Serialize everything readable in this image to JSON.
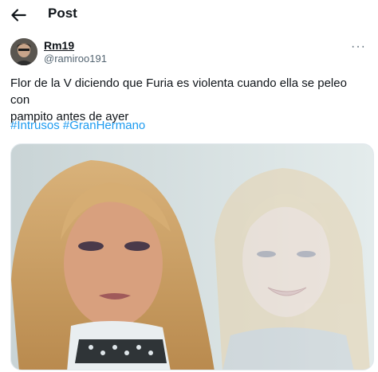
{
  "header": {
    "title": "Post",
    "back_icon": "arrow-left-icon"
  },
  "author": {
    "display_name": "Rm19",
    "handle": "@ramiroo191"
  },
  "tweet": {
    "text_line1": "Flor de la V  diciendo que Furia es violenta cuando ella se peleo con",
    "text_line2": "pampito antes de ayer",
    "hashtags": [
      "#Intrusos",
      "#GranHermano"
    ]
  },
  "colors": {
    "text": "#0f1419",
    "secondary": "#536471",
    "link": "#1d9bf0"
  }
}
